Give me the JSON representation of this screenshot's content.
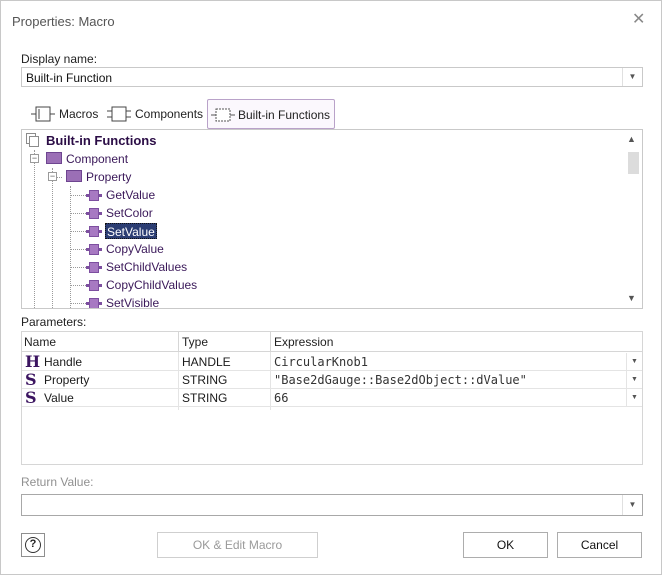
{
  "window": {
    "title": "Properties: Macro",
    "close_glyph": "✕"
  },
  "display_name": {
    "label": "Display name:",
    "value": "Built-in Function"
  },
  "tabs": [
    {
      "label": "Macros",
      "icon": "macro-icon"
    },
    {
      "label": "Components",
      "icon": "component-icon"
    },
    {
      "label": "Built-in Functions",
      "icon": "builtin-function-icon",
      "active": true
    }
  ],
  "tree": {
    "root": "Built-in Functions",
    "component": "Component",
    "property": "Property",
    "functions": [
      "GetValue",
      "SetColor",
      "SetValue",
      "CopyValue",
      "SetChildValues",
      "CopyChildValues",
      "SetVisible"
    ],
    "selected": "SetValue"
  },
  "parameters": {
    "label": "Parameters:",
    "columns": [
      "Name",
      "Type",
      "Expression"
    ],
    "rows": [
      {
        "glyph": "H",
        "name": "Handle",
        "type": "HANDLE",
        "expression": "CircularKnob1"
      },
      {
        "glyph": "S",
        "name": "Property",
        "type": "STRING",
        "expression": "\"Base2dGauge::Base2dObject::dValue\""
      },
      {
        "glyph": "S",
        "name": "Value",
        "type": "STRING",
        "expression": "66"
      }
    ]
  },
  "return_value": {
    "label": "Return Value:",
    "value": ""
  },
  "buttons": {
    "help": "?",
    "ok_edit": "OK & Edit Macro",
    "ok": "OK",
    "cancel": "Cancel"
  },
  "colors": {
    "accent": "#5b2d82",
    "selection": "#2b3d73"
  }
}
